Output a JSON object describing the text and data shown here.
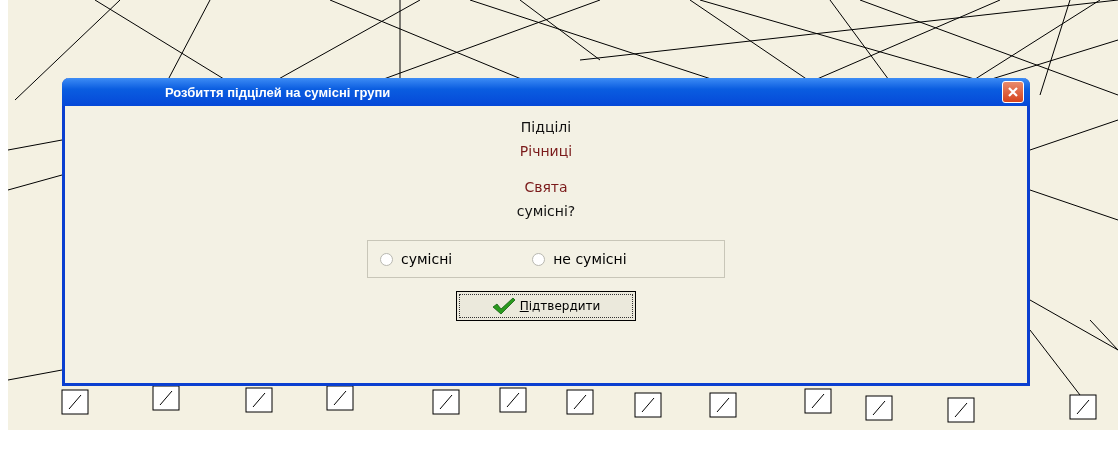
{
  "window": {
    "title": "Розбиття підцілей на сумісні групи"
  },
  "lines": [
    {
      "text": "Підцілі",
      "kind": "label"
    },
    {
      "text": "Річниці",
      "kind": "item"
    },
    {
      "text": "Свята",
      "kind": "item"
    },
    {
      "text": "сумісні?",
      "kind": "label"
    }
  ],
  "options": [
    {
      "label": "сумісні",
      "selected": false
    },
    {
      "label": "не сумісні",
      "selected": false
    }
  ],
  "button": {
    "label": "Підтвердити"
  }
}
